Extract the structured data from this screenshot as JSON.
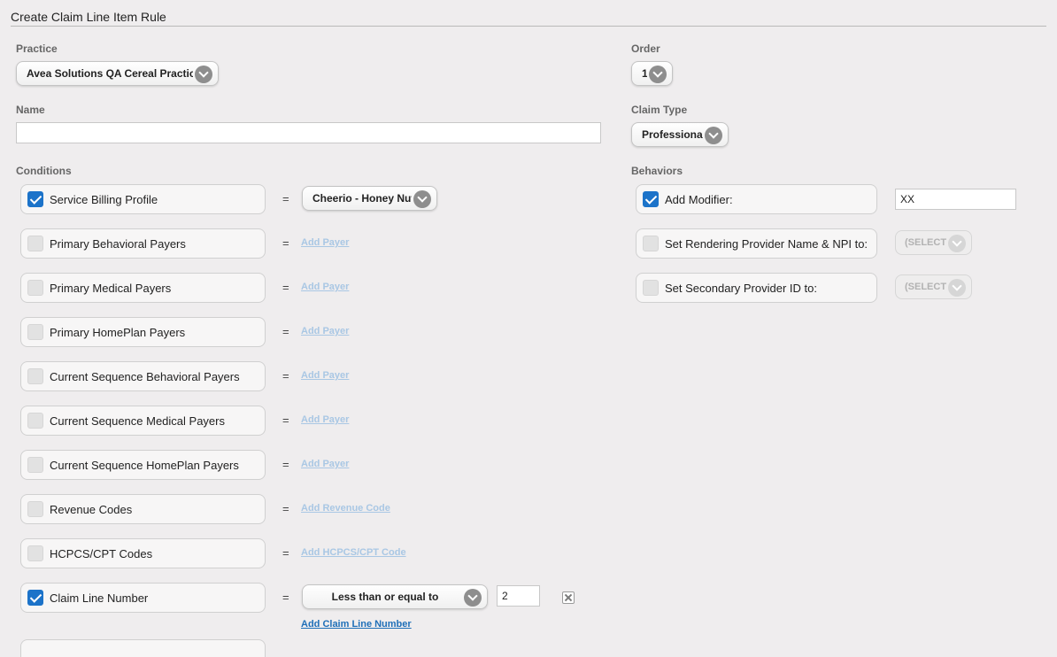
{
  "page": {
    "title": "Create Claim Line Item Rule"
  },
  "practice": {
    "label": "Practice",
    "value": "Avea Solutions QA Cereal Practice"
  },
  "order": {
    "label": "Order",
    "value": "1"
  },
  "name": {
    "label": "Name",
    "value": "",
    "placeholder": ""
  },
  "claim_type": {
    "label": "Claim Type",
    "value": "Professional"
  },
  "conditions": {
    "label": "Conditions",
    "equals": "=",
    "items": [
      {
        "label": "Service Billing Profile",
        "checked": true,
        "select_value": "Cheerio - Honey Nut"
      },
      {
        "label": "Primary Behavioral Payers",
        "checked": false,
        "link": "Add Payer"
      },
      {
        "label": "Primary Medical Payers",
        "checked": false,
        "link": "Add Payer"
      },
      {
        "label": "Primary HomePlan Payers",
        "checked": false,
        "link": "Add Payer"
      },
      {
        "label": "Current Sequence Behavioral Payers",
        "checked": false,
        "link": "Add Payer"
      },
      {
        "label": "Current Sequence Medical Payers",
        "checked": false,
        "link": "Add Payer"
      },
      {
        "label": "Current Sequence HomePlan Payers",
        "checked": false,
        "link": "Add Payer"
      },
      {
        "label": "Revenue Codes",
        "checked": false,
        "link": "Add Revenue Code"
      },
      {
        "label": "HCPCS/CPT Codes",
        "checked": false,
        "link": "Add HCPCS/CPT Code"
      },
      {
        "label": "Claim Line Number",
        "checked": true,
        "operator": "Less than or equal to",
        "value": "2",
        "link": "Add Claim Line Number"
      }
    ]
  },
  "behaviors": {
    "label": "Behaviors",
    "items": [
      {
        "label": "Add Modifier:",
        "checked": true,
        "value": "XX"
      },
      {
        "label": "Set Rendering Provider Name & NPI to:",
        "checked": false,
        "select_value": "(SELECT)"
      },
      {
        "label": "Set Secondary Provider ID to:",
        "checked": false,
        "select_value": "(SELECT)"
      }
    ]
  },
  "colors": {
    "accent": "#1c73c9",
    "link_active": "#1f6fb8",
    "link_disabled": "#a9c7e4"
  }
}
